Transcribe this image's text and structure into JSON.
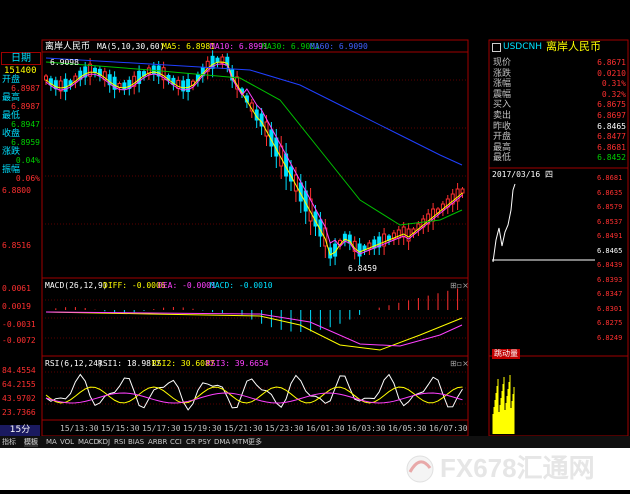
{
  "left_panel": {
    "tab_label": "日期",
    "time_value": "151400",
    "rows": [
      {
        "label": "开盘",
        "value": "6.8987",
        "color": "red"
      },
      {
        "label": "最高",
        "value": "6.8987",
        "color": "red"
      },
      {
        "label": "最低",
        "value": "6.8947",
        "color": "green"
      },
      {
        "label": "收盘",
        "value": "6.8959",
        "color": "green"
      },
      {
        "label": "涨跌",
        "value": "0.04%",
        "color": "green"
      },
      {
        "label": "振幅",
        "value": "0.06%",
        "color": "red"
      }
    ],
    "extra_values": [
      "6.8998",
      "6.8800",
      "6.8516"
    ]
  },
  "main_chart": {
    "title": "离岸人民币",
    "ma_params": "MA(5,10,30,60)",
    "ma5": "MA5: 6.8981",
    "ma10": "MA10: 6.8991",
    "ma30": "MA30: 6.9001",
    "ma60": "MA60: 6.9090",
    "high_marker": "6.9098",
    "low_marker": "6.8459",
    "y_ticks": [
      "6.8998",
      "6.8800",
      "6.8516"
    ]
  },
  "macd": {
    "title": "MACD(26,12,9)",
    "diff": "DIFF: -0.0006",
    "dea": "DEA: -0.0001",
    "macd": "MACD: -0.0010",
    "y_ticks": [
      "0.0061",
      "0.0019",
      "-0.0031",
      "-0.0072"
    ]
  },
  "rsi": {
    "title": "RSI(6,12,24)",
    "rsi1": "RSI1: 18.9817",
    "rsi2": "RSI2: 30.6087",
    "rsi3": "RSI3: 39.6654",
    "y_ticks": [
      "84.4554",
      "64.2155",
      "43.9702",
      "23.7366"
    ]
  },
  "x_axis": [
    "15/13:30",
    "15/15:30",
    "15/17:30",
    "15/19:30",
    "15/21:30",
    "15/23:30",
    "16/01:30",
    "16/03:30",
    "16/05:30",
    "16/07:30"
  ],
  "bottom": {
    "period": "15分",
    "tabs": [
      "指标",
      "模板",
      "MA",
      "VOL",
      "MACD",
      "KDJ",
      "RSI",
      "BIAS",
      "ARBR",
      "CCI",
      "CR",
      "PSY",
      "DMA",
      "MTM",
      "更多"
    ]
  },
  "quote_panel": {
    "symbol": "USDCNH",
    "name": "离岸人民币",
    "rows": [
      {
        "label": "现价",
        "value": "6.8671",
        "color": "red"
      },
      {
        "label": "涨跌",
        "value": "0.0210",
        "color": "red"
      },
      {
        "label": "涨幅",
        "value": "0.31%",
        "color": "red"
      },
      {
        "label": "震幅",
        "value": "0.32%",
        "color": "red"
      },
      {
        "label": "买入",
        "value": "6.8675",
        "color": "red"
      },
      {
        "label": "卖出",
        "value": "6.8697",
        "color": "red"
      },
      {
        "label": "昨收",
        "value": "6.8465",
        "color": "white"
      },
      {
        "label": "开盘",
        "value": "6.8477",
        "color": "red"
      },
      {
        "label": "最高",
        "value": "6.8681",
        "color": "red"
      },
      {
        "label": "最低",
        "value": "6.8452",
        "color": "green"
      }
    ],
    "date_label": "2017/03/16 四",
    "mini_y_ticks": [
      "6.8681",
      "6.8635",
      "6.8579",
      "6.8537",
      "6.8491",
      "6.8465",
      "6.8439",
      "6.8393",
      "6.8347",
      "6.8301",
      "6.8275",
      "6.8249"
    ],
    "vol_title": "跳动量",
    "bottom_tab": "筹码"
  },
  "watermark": "FX678汇通网"
}
